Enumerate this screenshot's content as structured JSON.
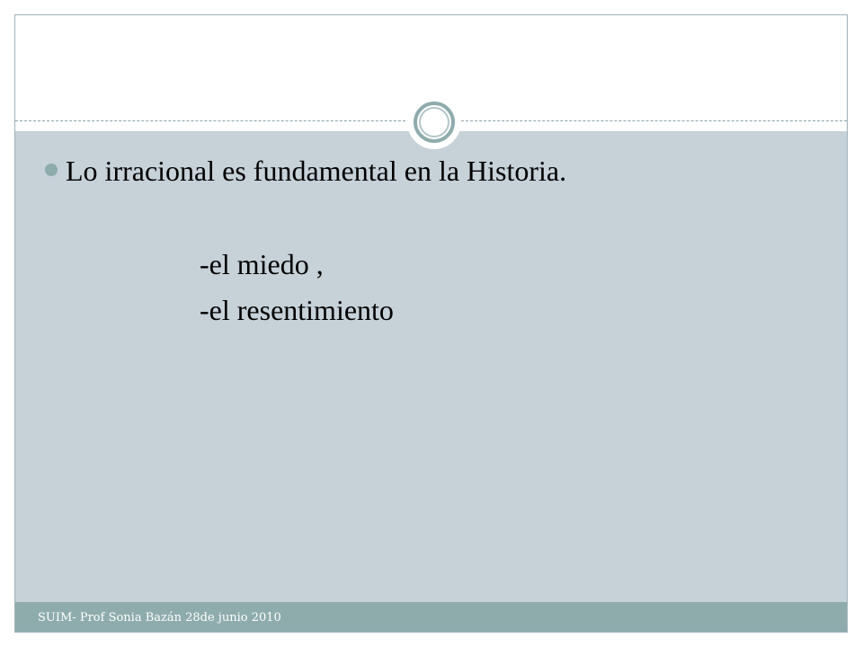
{
  "slide": {
    "bullet_text": "Lo irracional es fundamental en la Historia.",
    "sub_items": [
      "-el miedo ,",
      "-el resentimiento"
    ]
  },
  "footer": {
    "text": "SUIM- Prof Sonia Bazán  28de junio 2010"
  },
  "colors": {
    "body_background": "#c6d1d8",
    "footer_background": "#8eacac",
    "accent": "#8eacac"
  }
}
